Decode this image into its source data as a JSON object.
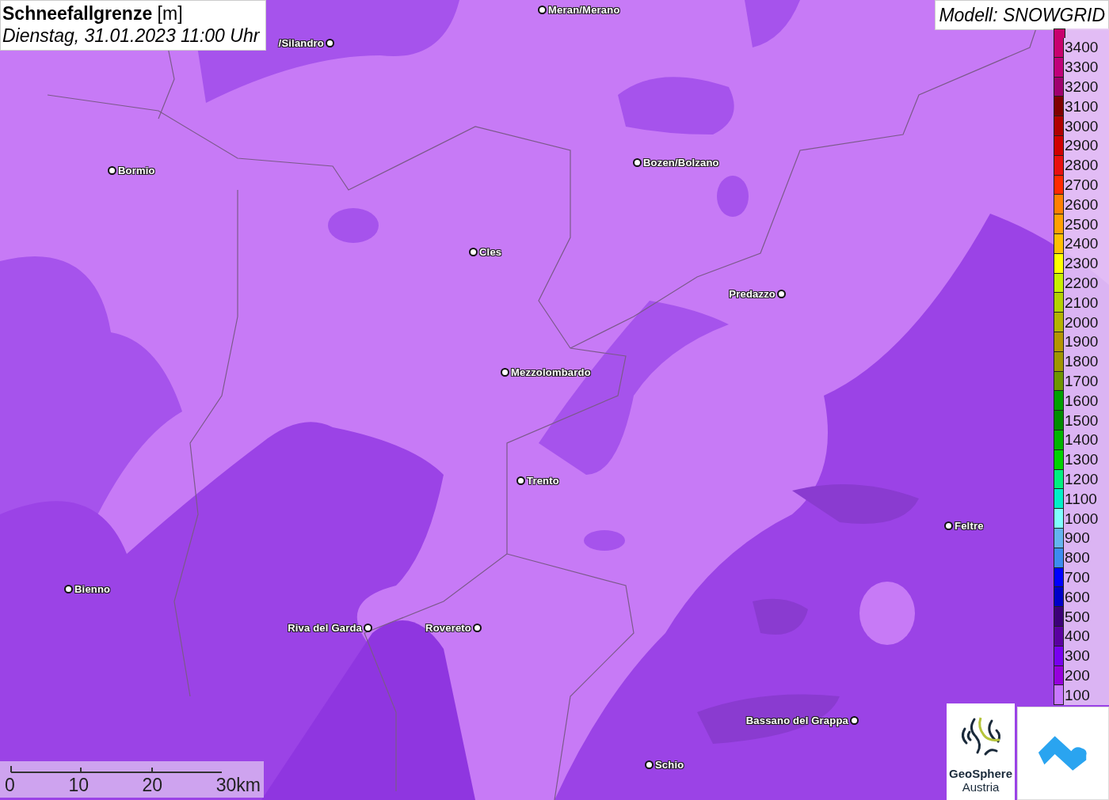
{
  "title": {
    "name": "Schneefallgrenze",
    "unit": "[m]",
    "datetime": "Dienstag, 31.01.2023 11:00 Uhr"
  },
  "model": "Modell: SNOWGRID",
  "places": [
    {
      "name": "Meran/Merano",
      "kind": "right"
    },
    {
      "name": "/Silandro",
      "kind": "left"
    },
    {
      "name": "Bormio",
      "kind": "right"
    },
    {
      "name": "Bozen/Bolzano",
      "kind": "right"
    },
    {
      "name": "Cles",
      "kind": "right"
    },
    {
      "name": "Predazzo",
      "kind": "left"
    },
    {
      "name": "Mezzolombardo",
      "kind": "right"
    },
    {
      "name": "Trento",
      "kind": "right"
    },
    {
      "name": "Feltre",
      "kind": "right"
    },
    {
      "name": "Bienno",
      "kind": "right"
    },
    {
      "name": "Riva del Garda",
      "kind": "left"
    },
    {
      "name": "Rovereto",
      "kind": "left"
    },
    {
      "name": "Bassano del Grappa",
      "kind": "left"
    },
    {
      "name": "Schio",
      "kind": "right"
    }
  ],
  "legend": [
    {
      "label": "3400",
      "color": "#c8006e"
    },
    {
      "label": "3300",
      "color": "#c0007a"
    },
    {
      "label": "3200",
      "color": "#a0006e"
    },
    {
      "label": "3100",
      "color": "#800000"
    },
    {
      "label": "3000",
      "color": "#b00000"
    },
    {
      "label": "2900",
      "color": "#d00000"
    },
    {
      "label": "2800",
      "color": "#e81010"
    },
    {
      "label": "2700",
      "color": "#ff2a00"
    },
    {
      "label": "2600",
      "color": "#ff8000"
    },
    {
      "label": "2500",
      "color": "#ffa000"
    },
    {
      "label": "2400",
      "color": "#ffc000"
    },
    {
      "label": "2300",
      "color": "#ffff00"
    },
    {
      "label": "2200",
      "color": "#c8f000"
    },
    {
      "label": "2100",
      "color": "#b4d200"
    },
    {
      "label": "2000",
      "color": "#b4b400"
    },
    {
      "label": "1900",
      "color": "#b49600"
    },
    {
      "label": "1800",
      "color": "#a09600"
    },
    {
      "label": "1700",
      "color": "#6e9600"
    },
    {
      "label": "1600",
      "color": "#00a000"
    },
    {
      "label": "1500",
      "color": "#008c00"
    },
    {
      "label": "1400",
      "color": "#00b400"
    },
    {
      "label": "1300",
      "color": "#00d200"
    },
    {
      "label": "1200",
      "color": "#00f080"
    },
    {
      "label": "1100",
      "color": "#00f0c8"
    },
    {
      "label": "1000",
      "color": "#80ffff"
    },
    {
      "label": "900",
      "color": "#64b4f0"
    },
    {
      "label": "800",
      "color": "#3c8cf0"
    },
    {
      "label": "700",
      "color": "#0000ff"
    },
    {
      "label": "600",
      "color": "#0000c8"
    },
    {
      "label": "500",
      "color": "#3c0078"
    },
    {
      "label": "400",
      "color": "#5a00a0"
    },
    {
      "label": "300",
      "color": "#7800f0"
    },
    {
      "label": "200",
      "color": "#9600dc"
    },
    {
      "label": "100",
      "color": "#c878ff"
    }
  ],
  "scale_bar": {
    "ticks": [
      "0",
      "10",
      "20",
      "30km"
    ]
  },
  "logos": {
    "geosphere": {
      "line_1": "GeoSphere",
      "line_2": "Austria"
    }
  }
}
